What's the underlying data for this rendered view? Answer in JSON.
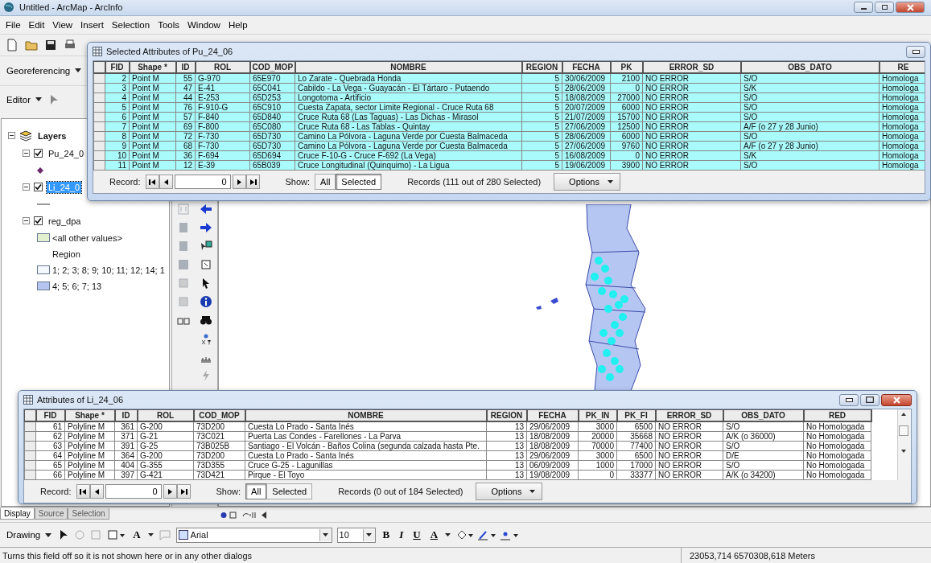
{
  "window": {
    "title": "Untitled - ArcMap - ArcInfo"
  },
  "menu": [
    "File",
    "Edit",
    "View",
    "Insert",
    "Selection",
    "Tools",
    "Window",
    "Help"
  ],
  "toolbars": {
    "georeferencing": "Georeferencing",
    "editor": "Editor"
  },
  "toc": {
    "root": "Layers",
    "layers": [
      {
        "name": "Pu_24_0",
        "checked": true,
        "selected": false,
        "kind": "point"
      },
      {
        "name": "Li_24_0",
        "checked": true,
        "selected": true,
        "kind": "line"
      },
      {
        "name": "reg_dpa",
        "checked": true,
        "selected": false,
        "kind": "polygon",
        "legend": [
          {
            "kind": "patch",
            "label": "<all other values>",
            "color": "#e3f0cf"
          },
          {
            "kind": "heading",
            "label": "Region"
          },
          {
            "kind": "patch",
            "label": "1; 2; 3; 8; 9; 10; 11; 12; 14; 1",
            "color": "#f4f8ff"
          },
          {
            "kind": "patch",
            "label": "4; 5; 6; 7; 13",
            "color": "#b4c6f0"
          }
        ]
      }
    ],
    "tabs": [
      {
        "label": "Display",
        "selected": true
      },
      {
        "label": "Source",
        "selected": false
      },
      {
        "label": "Selection",
        "selected": false
      }
    ]
  },
  "top_table": {
    "title": "Selected Attributes of Pu_24_06",
    "columns": [
      {
        "label": "FID",
        "kind": "number"
      },
      {
        "label": "Shape *",
        "kind": "text"
      },
      {
        "label": "ID",
        "kind": "number"
      },
      {
        "label": "ROL",
        "kind": "text"
      },
      {
        "label": "COD_MOP",
        "kind": "text"
      },
      {
        "label": "NOMBRE",
        "kind": "text"
      },
      {
        "label": "REGION",
        "kind": "number"
      },
      {
        "label": "FECHA",
        "kind": "text"
      },
      {
        "label": "PK",
        "kind": "number"
      },
      {
        "label": "ERROR_SD",
        "kind": "text"
      },
      {
        "label": "OBS_DATO",
        "kind": "text"
      },
      {
        "label": "RE",
        "kind": "text"
      }
    ],
    "rows": [
      {
        "selected": true,
        "cells": [
          "2",
          "Point M",
          "55",
          "G-970",
          "65E970",
          "Lo Zarate - Quebrada Honda",
          "5",
          "30/06/2009",
          "2100",
          "NO ERROR",
          "S/O",
          "Homologa"
        ]
      },
      {
        "selected": true,
        "cells": [
          "3",
          "Point M",
          "47",
          "E-41",
          "65C041",
          "Cabildo - La Vega - Guayacán - El Tártaro - Putaendo",
          "5",
          "28/06/2009",
          "0",
          "NO ERROR",
          "S/K",
          "Homologa"
        ]
      },
      {
        "selected": true,
        "cells": [
          "4",
          "Point M",
          "44",
          "E-253",
          "65D253",
          "Longotoma - Artificio",
          "5",
          "18/08/2009",
          "27000",
          "NO ERROR",
          "S/O",
          "Homologa"
        ]
      },
      {
        "selected": true,
        "cells": [
          "5",
          "Point M",
          "76",
          "F-910-G",
          "65C910",
          "Cuesta Zapata, sector Limite Regional - Cruce Ruta 68",
          "5",
          "20/07/2009",
          "6000",
          "NO ERROR",
          "S/O",
          "Homologa"
        ]
      },
      {
        "selected": true,
        "cells": [
          "6",
          "Point M",
          "57",
          "F-840",
          "65D840",
          "Cruce Ruta 68 (Las Taguas) - Las Dichas - Mirasol",
          "5",
          "21/07/2009",
          "15700",
          "NO ERROR",
          "S/O",
          "Homologa"
        ]
      },
      {
        "selected": true,
        "cells": [
          "7",
          "Point M",
          "69",
          "F-800",
          "65C080",
          "Cruce Ruta 68 - Las Tablas - Quintay",
          "5",
          "27/06/2009",
          "12500",
          "NO ERROR",
          "A/F (o 27 y 28 Junio)",
          "Homologa"
        ]
      },
      {
        "selected": true,
        "cells": [
          "8",
          "Point M",
          "72",
          "F-730",
          "65D730",
          "Camino La Pólvora - Laguna Verde por Cuesta Balmaceda",
          "5",
          "28/06/2009",
          "6000",
          "NO ERROR",
          "S/O",
          "Homologa"
        ]
      },
      {
        "selected": true,
        "cells": [
          "9",
          "Point M",
          "68",
          "F-730",
          "65D730",
          "Camino La Pólvora - Laguna Verde por Cuesta Balmaceda",
          "5",
          "27/06/2009",
          "9760",
          "NO ERROR",
          "A/F (o 27 y 28 Junio)",
          "Homologa"
        ]
      },
      {
        "selected": true,
        "cells": [
          "10",
          "Point M",
          "36",
          "F-694",
          "65D694",
          "Cruce F-10-G - Cruce F-692 (La Vega)",
          "5",
          "16/08/2009",
          "0",
          "NO ERROR",
          "S/K",
          "Homologa"
        ]
      },
      {
        "selected": true,
        "cells": [
          "11",
          "Point M",
          "12",
          "E-39",
          "65B039",
          "Cruce Longitudinal (Quinquimo) - La Ligua",
          "5",
          "19/06/2009",
          "3900",
          "NO ERROR",
          "S/O",
          "Homologa"
        ]
      }
    ],
    "record_label": "Record:",
    "record": "0",
    "show_label": "Show:",
    "show_options": [
      {
        "label": "All",
        "selected": false
      },
      {
        "label": "Selected",
        "selected": true
      }
    ],
    "summary": "Records (111 out of 280 Selected)",
    "options": "Options"
  },
  "bottom_table": {
    "title": "Attributes of Li_24_06",
    "columns": [
      {
        "label": "FID",
        "kind": "number"
      },
      {
        "label": "Shape *",
        "kind": "text"
      },
      {
        "label": "ID",
        "kind": "number"
      },
      {
        "label": "ROL",
        "kind": "text"
      },
      {
        "label": "COD_MOP",
        "kind": "text"
      },
      {
        "label": "NOMBRE",
        "kind": "text"
      },
      {
        "label": "REGION",
        "kind": "number"
      },
      {
        "label": "FECHA",
        "kind": "text"
      },
      {
        "label": "PK_IN",
        "kind": "number"
      },
      {
        "label": "PK_FI",
        "kind": "number"
      },
      {
        "label": "ERROR_SD",
        "kind": "text"
      },
      {
        "label": "OBS_DATO",
        "kind": "text"
      },
      {
        "label": "RED",
        "kind": "text"
      }
    ],
    "rows": [
      {
        "selected": false,
        "cells": [
          "61",
          "Polyline M",
          "361",
          "G-200",
          "73D200",
          "Cuesta Lo Prado - Santa Inés",
          "13",
          "29/06/2009",
          "3000",
          "6500",
          "NO ERROR",
          "S/O",
          "No Homologada"
        ]
      },
      {
        "selected": false,
        "cells": [
          "62",
          "Polyline M",
          "371",
          "G-21",
          "73C021",
          "Puerta Las Condes - Farellones - La Parva",
          "13",
          "18/08/2009",
          "20000",
          "35668",
          "NO ERROR",
          "A/K (o 36000)",
          "No Homologada"
        ]
      },
      {
        "selected": false,
        "cells": [
          "63",
          "Polyline M",
          "391",
          "G-25",
          "73B025B",
          "Santiago - El Volcán - Baños Colina (segunda calzada hasta Pte.",
          "13",
          "18/08/2009",
          "70000",
          "77400",
          "NO ERROR",
          "S/O",
          "No Homologada"
        ]
      },
      {
        "selected": false,
        "cells": [
          "64",
          "Polyline M",
          "364",
          "G-200",
          "73D200",
          "Cuesta Lo Prado - Santa Inés",
          "13",
          "29/06/2009",
          "3000",
          "6500",
          "NO ERROR",
          "D/E",
          "No Homologada"
        ]
      },
      {
        "selected": false,
        "cells": [
          "65",
          "Polyline M",
          "404",
          "G-355",
          "73D355",
          "Cruce G-25 - Lagunillas",
          "13",
          "06/09/2009",
          "1000",
          "17000",
          "NO ERROR",
          "S/O",
          "No Homologada"
        ]
      },
      {
        "selected": false,
        "cells": [
          "66",
          "Polyline M",
          "397",
          "G-421",
          "73D421",
          "Pirque - El Toyo",
          "13",
          "19/08/2009",
          "0",
          "33377",
          "NO ERROR",
          "A/K (o 34200)",
          "No Homologada"
        ]
      }
    ],
    "record_label": "Record:",
    "record": "0",
    "show_label": "Show:",
    "show_options": [
      {
        "label": "All",
        "selected": true
      },
      {
        "label": "Selected",
        "selected": false
      }
    ],
    "summary": "Records (0 out of 184 Selected)",
    "options": "Options"
  },
  "drawing_toolbar": {
    "menu": "Drawing",
    "text_tool": "A",
    "font": "Arial",
    "size": "10",
    "bold": "B",
    "italic": "I",
    "underline": "U",
    "font_color": "A"
  },
  "status_bar": {
    "message": "Turns this field off so it is not shown here or in any other dialogs",
    "coordinates": "23053,714  6570308,618 Meters"
  }
}
